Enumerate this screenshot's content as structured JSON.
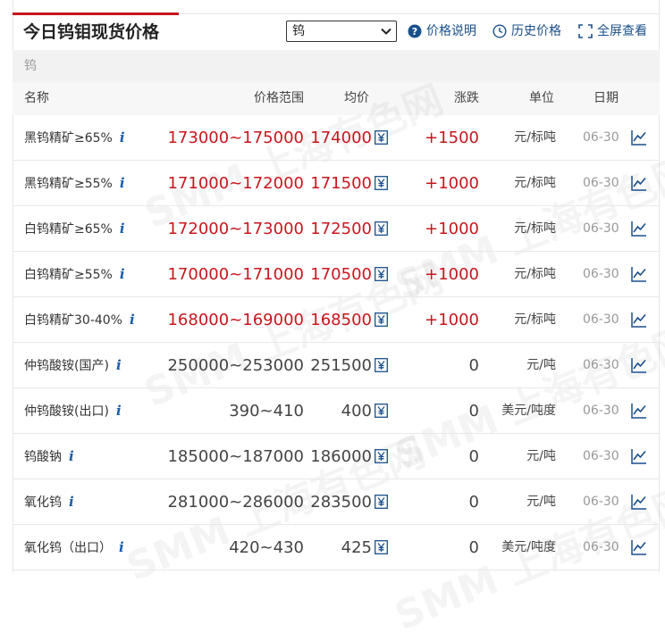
{
  "title": "今日钨钼现货价格",
  "select": {
    "value": "钨"
  },
  "toolbar": {
    "price_note": "价格说明",
    "history": "历史价格",
    "fullscreen": "全屏查看"
  },
  "category": "钨",
  "columns": {
    "name": "名称",
    "range": "价格范围",
    "avg": "均价",
    "change": "涨跌",
    "unit": "单位",
    "date": "日期"
  },
  "watermark": "SMM 上海有色网",
  "colors": {
    "up": "#c8161d",
    "link": "#1a4f8b",
    "accent": "#c8161d"
  },
  "rows": [
    {
      "name": "黑钨精矿≥65%",
      "range": "173000~175000",
      "avg": "174000",
      "change": "+1500",
      "unit": "元/标吨",
      "date": "06-30",
      "trend": "up"
    },
    {
      "name": "黑钨精矿≥55%",
      "range": "171000~172000",
      "avg": "171500",
      "change": "+1000",
      "unit": "元/标吨",
      "date": "06-30",
      "trend": "up"
    },
    {
      "name": "白钨精矿≥65%",
      "range": "172000~173000",
      "avg": "172500",
      "change": "+1000",
      "unit": "元/标吨",
      "date": "06-30",
      "trend": "up"
    },
    {
      "name": "白钨精矿≥55%",
      "range": "170000~171000",
      "avg": "170500",
      "change": "+1000",
      "unit": "元/标吨",
      "date": "06-30",
      "trend": "up"
    },
    {
      "name": "白钨精矿30-40%",
      "range": "168000~169000",
      "avg": "168500",
      "change": "+1000",
      "unit": "元/标吨",
      "date": "06-30",
      "trend": "up"
    },
    {
      "name": "仲钨酸铵(国产)",
      "range": "250000~253000",
      "avg": "251500",
      "change": "0",
      "unit": "元/吨",
      "date": "06-30",
      "trend": "flat"
    },
    {
      "name": "仲钨酸铵(出口)",
      "range": "390~410",
      "avg": "400",
      "change": "0",
      "unit": "美元/吨度",
      "date": "06-30",
      "trend": "flat"
    },
    {
      "name": "钨酸钠",
      "range": "185000~187000",
      "avg": "186000",
      "change": "0",
      "unit": "元/吨",
      "date": "06-30",
      "trend": "flat"
    },
    {
      "name": "氧化钨",
      "range": "281000~286000",
      "avg": "283500",
      "change": "0",
      "unit": "元/吨",
      "date": "06-30",
      "trend": "flat"
    },
    {
      "name": "氧化钨（出口）",
      "range": "420~430",
      "avg": "425",
      "change": "0",
      "unit": "美元/吨度",
      "date": "06-30",
      "trend": "flat"
    }
  ]
}
